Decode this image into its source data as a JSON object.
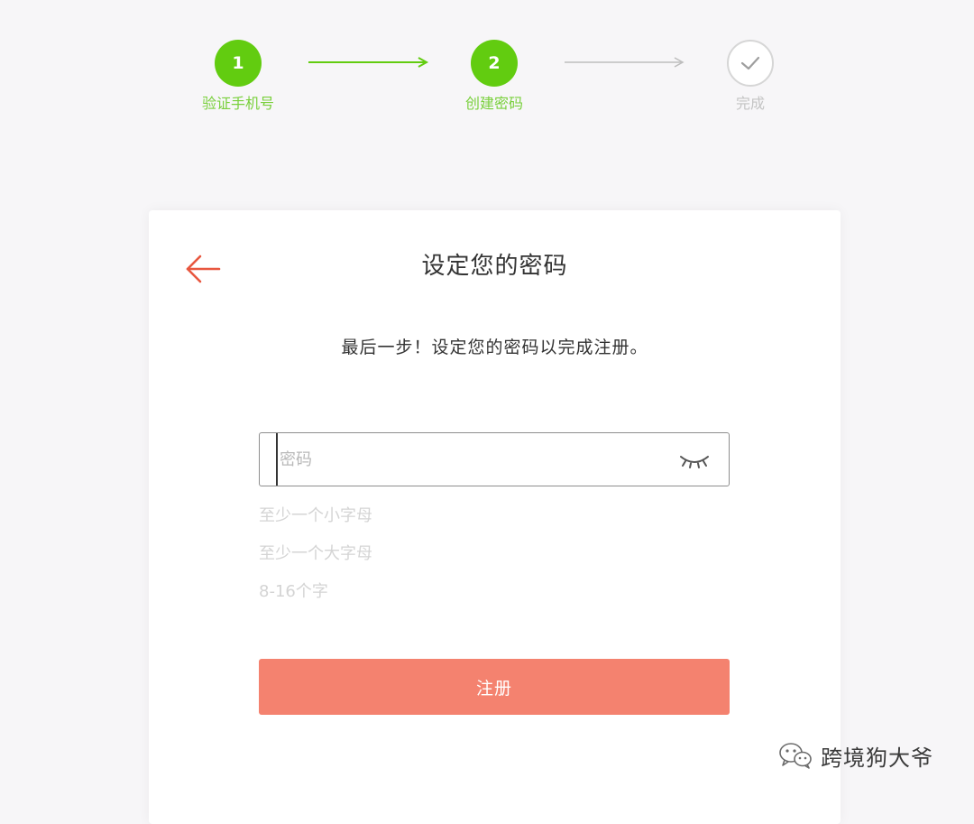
{
  "stepper": {
    "steps": [
      {
        "number": "1",
        "label": "验证手机号",
        "state": "done"
      },
      {
        "number": "2",
        "label": "创建密码",
        "state": "done"
      },
      {
        "number": "",
        "label": "完成",
        "state": "todo"
      }
    ],
    "icon_done_final": "check-icon",
    "colors": {
      "active": "#62cc10",
      "active_label": "#79d03c",
      "inactive": "#d6d6d6",
      "inactive_label": "#c4c4c4"
    }
  },
  "card": {
    "title": "设定您的密码",
    "subtitle": "最后一步！设定您的密码以完成注册。",
    "back_icon": "arrow-left-icon",
    "password": {
      "value": "",
      "placeholder": "密码",
      "toggle_icon": "eye-closed-icon"
    },
    "rules": [
      "至少一个小字母",
      "至少一个大字母",
      "8-16个字"
    ],
    "register_label": "注册",
    "colors": {
      "accent": "#f4826f",
      "arrow": "#e8573f"
    }
  },
  "watermark": {
    "text": "跨境狗大爷",
    "icon": "wechat-icon"
  }
}
